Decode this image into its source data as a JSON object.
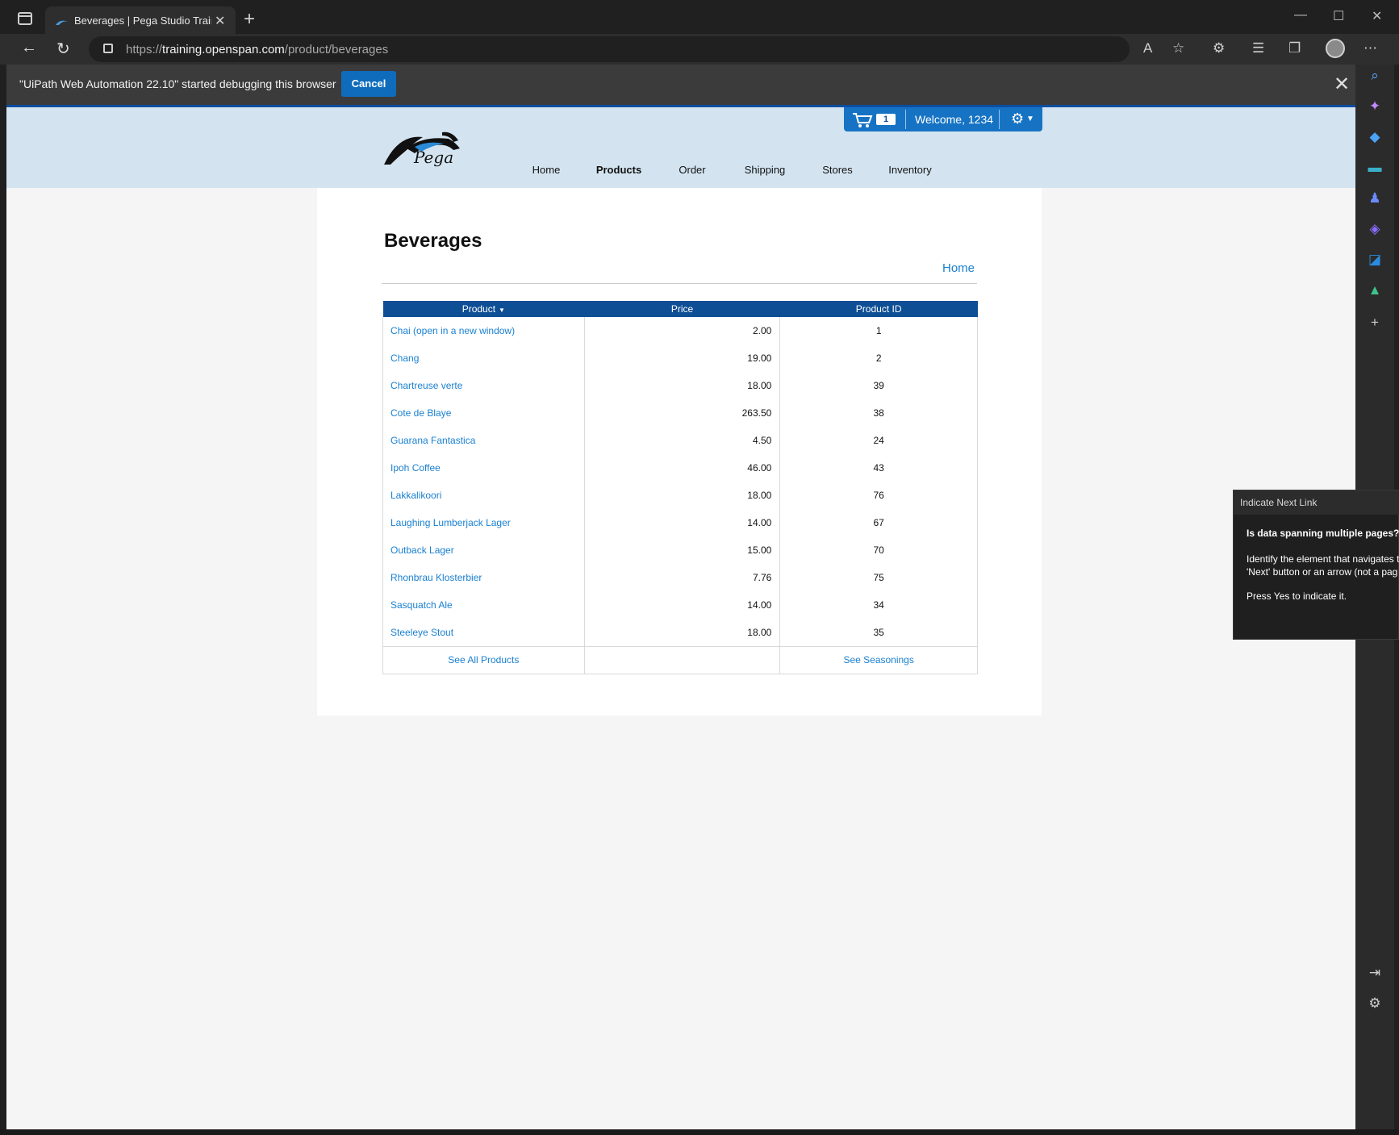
{
  "browser": {
    "tab_title": "Beverages | Pega Studio Training",
    "url_prefix": "https://",
    "url_host": "training.openspan.com",
    "url_path": "/product/beverages"
  },
  "infobar": {
    "message": "\"UiPath Web Automation 22.10\" started debugging this browser",
    "cancel_label": "Cancel"
  },
  "site": {
    "logo_text": "Pega",
    "cart_count": "1",
    "welcome": "Welcome, 1234",
    "nav": [
      "Home",
      "Products",
      "Order",
      "Shipping",
      "Stores",
      "Inventory"
    ],
    "active_nav": "Products"
  },
  "main": {
    "title": "Beverages",
    "home_link": "Home",
    "table": {
      "columns": [
        "Product",
        "Price",
        "Product ID"
      ],
      "rows": [
        {
          "product": "Chai  (open in a new window)",
          "price": "2.00",
          "id": "1"
        },
        {
          "product": "Chang",
          "price": "19.00",
          "id": "2"
        },
        {
          "product": "Chartreuse verte",
          "price": "18.00",
          "id": "39"
        },
        {
          "product": "Cote de Blaye",
          "price": "263.50",
          "id": "38"
        },
        {
          "product": "Guarana Fantastica",
          "price": "4.50",
          "id": "24"
        },
        {
          "product": "Ipoh Coffee",
          "price": "46.00",
          "id": "43"
        },
        {
          "product": "Lakkalikoori",
          "price": "18.00",
          "id": "76"
        },
        {
          "product": "Laughing Lumberjack Lager",
          "price": "14.00",
          "id": "67"
        },
        {
          "product": "Outback Lager",
          "price": "15.00",
          "id": "70"
        },
        {
          "product": "Rhonbrau Klosterbier",
          "price": "7.76",
          "id": "75"
        },
        {
          "product": "Sasquatch Ale",
          "price": "14.00",
          "id": "34"
        },
        {
          "product": "Steeleye Stout",
          "price": "18.00",
          "id": "35"
        }
      ],
      "footer_left": "See All Products",
      "footer_right": "See Seasonings"
    }
  },
  "popup": {
    "title": "Indicate Next Link",
    "question": "Is data spanning multiple pages?",
    "line1": "Identify the element that navigates t",
    "line2": "'Next' button or an arrow (not a pag",
    "line3": "Press Yes to indicate it."
  },
  "colors": {
    "accent": "#1673c4",
    "table_header": "#0e4e95",
    "link": "#1a80d0",
    "header_bg": "#d3e4f0"
  }
}
